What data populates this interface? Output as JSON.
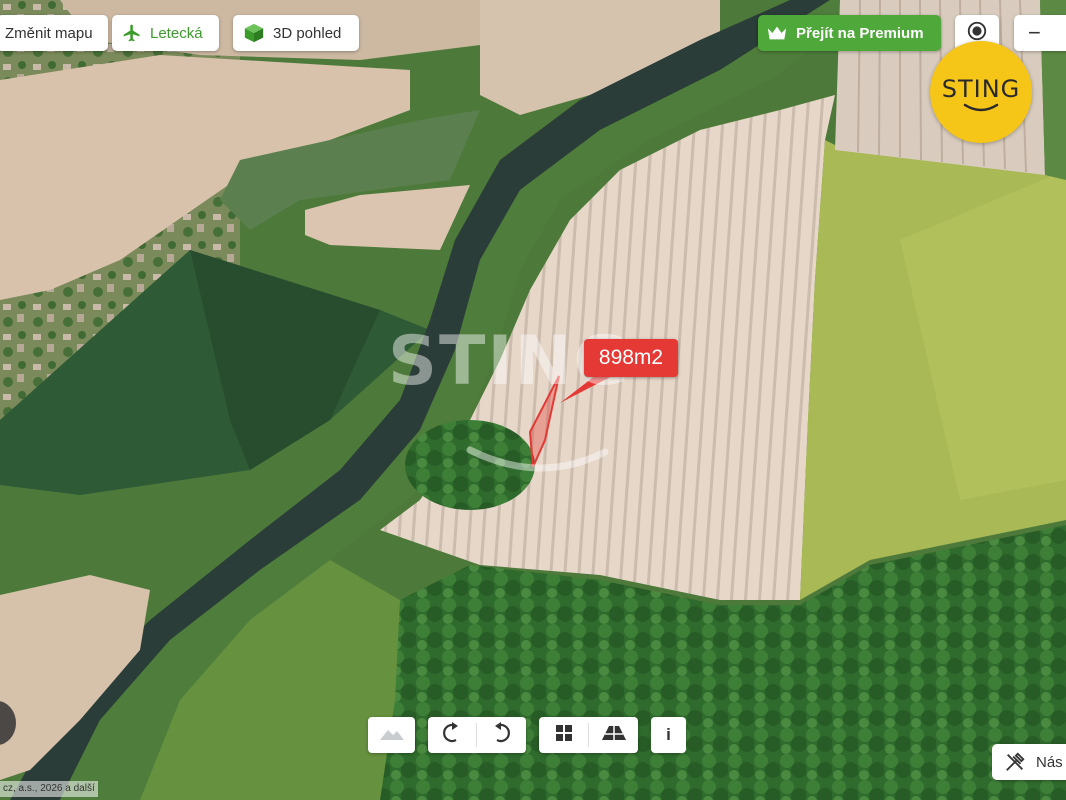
{
  "toolbar": {
    "change_map_label": "Změnit mapu",
    "aerial_label": "Letecká",
    "view3d_label": "3D pohled",
    "premium_label": "Přejít na Premium",
    "zoom_out_symbol": "−"
  },
  "map": {
    "area_label": "898m2",
    "watermark_text": "STING"
  },
  "logo": {
    "text": "STING"
  },
  "bottom_controls": {
    "info_label": "i",
    "nas_label": "Nás"
  },
  "copyright": "cz, a.s., 2026 a další",
  "icons": [
    "airplane-icon",
    "cube-icon",
    "crown-icon",
    "target-icon",
    "minus-icon",
    "terrain-icon",
    "rotate-left-icon",
    "rotate-right-icon",
    "grid-icon",
    "perspective-icon",
    "info-icon",
    "tools-icon"
  ],
  "colors": {
    "accent_green": "#4fa83a",
    "area_red": "#e53935",
    "logo_yellow": "#f5c518"
  }
}
